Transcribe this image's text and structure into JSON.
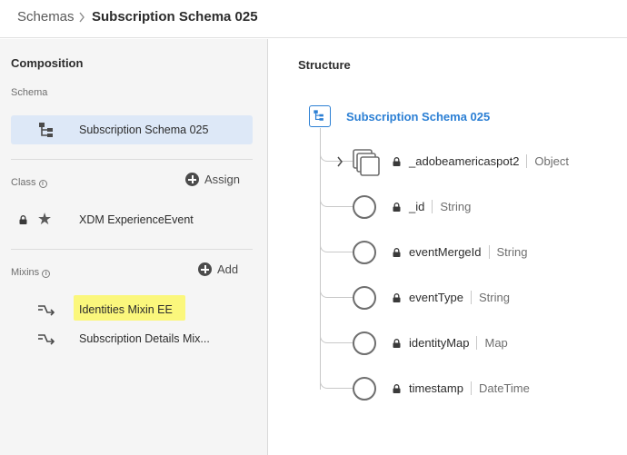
{
  "breadcrumb": {
    "root": "Schemas",
    "current": "Subscription Schema 025"
  },
  "composition": {
    "title": "Composition",
    "schema_label": "Schema",
    "schema_name": "Subscription Schema 025",
    "class_label": "Class",
    "assign_label": "Assign",
    "class_name": "XDM ExperienceEvent",
    "mixins_label": "Mixins",
    "add_label": "Add",
    "mixins": [
      {
        "name": "Identities Mixin EE",
        "highlighted": true
      },
      {
        "name": "Subscription Details Mix...",
        "highlighted": false
      }
    ],
    "highlight_color": "#fbf77c"
  },
  "structure": {
    "title": "Structure",
    "root_name": "Subscription Schema 025",
    "accent_color": "#2b7fd4",
    "fields": [
      {
        "name": "_adobeamericaspot2",
        "type": "Object",
        "icon": "object-icon",
        "expandable": true
      },
      {
        "name": "_id",
        "type": "String",
        "icon": "field-circle-icon",
        "expandable": false
      },
      {
        "name": "eventMergeId",
        "type": "String",
        "icon": "field-circle-icon",
        "expandable": false
      },
      {
        "name": "eventType",
        "type": "String",
        "icon": "field-circle-icon",
        "expandable": false
      },
      {
        "name": "identityMap",
        "type": "Map",
        "icon": "field-circle-icon",
        "expandable": false
      },
      {
        "name": "timestamp",
        "type": "DateTime",
        "icon": "field-circle-icon",
        "expandable": false
      }
    ]
  }
}
